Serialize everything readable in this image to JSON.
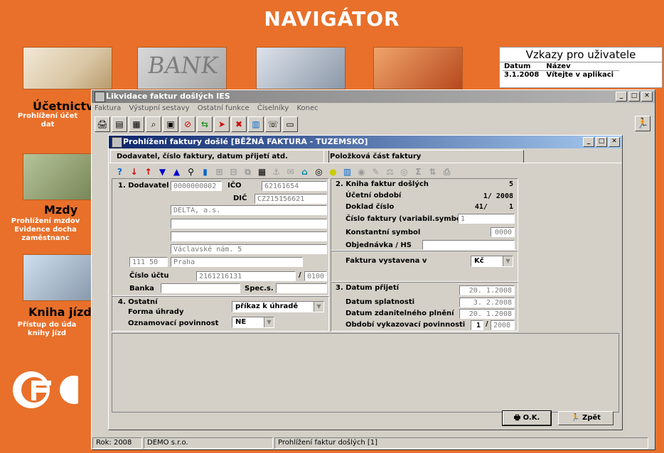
{
  "background": {
    "title": "NAVIGÁTOR",
    "modules": [
      {
        "title": "Účetnictví",
        "desc": [
          "Prohlížení účet",
          "dat"
        ]
      },
      {
        "title": "Mzdy",
        "desc": [
          "Prohlížení mzdov",
          "Evidence docha",
          "zaměstnanc"
        ]
      },
      {
        "title": "Kniha jízd",
        "desc": [
          "Přístup do úda",
          "knihy jízd"
        ]
      }
    ],
    "bank_word": "BANK",
    "messages": {
      "title": "Vzkazy pro uživatele",
      "col_date": "Datum",
      "col_name": "Název",
      "rows": [
        {
          "date": "3.1.2008",
          "name": "Vítejte v aplikaci"
        }
      ]
    }
  },
  "outer_window": {
    "title": "Likvidace faktur došlých  IES",
    "menu": [
      "Faktura",
      "Výstupní sestavy",
      "Ostatní funkce",
      "Číselníky",
      "Konec"
    ],
    "status": [
      "Rok: 2008",
      "DEMO s.r.o.",
      "Prohlížení faktur došlých [1]"
    ]
  },
  "inner_window": {
    "title": "Prohlížení faktury došlé  [BĚŽNÁ FAKTURA - TUZEMSKO]",
    "tabs": [
      "Dodavatel, číslo faktury, datum přijetí atd.",
      "Položková část faktury"
    ],
    "supplier": {
      "section_label": "1. Dodavatel",
      "code": "0000000002",
      "ico_label": "IČO",
      "ico": "62161654",
      "dic_label": "DIČ",
      "dic": "CZ215156621",
      "name": "DELTA, a.s.",
      "line2": "",
      "line3": "",
      "street": "Václavské nám. 5",
      "zip": "111 50",
      "city": "Praha",
      "account_label": "Číslo účtu",
      "account": "2161216131",
      "bank_code": "0100",
      "bank_label": "Banka",
      "bank": "",
      "spec_label": "Spec.s.",
      "spec": ""
    },
    "book": {
      "section_label": "2. Kniha faktur došlých",
      "book_no": "5",
      "period_label": "Účetní období",
      "period": "1/ 2008",
      "doc_label": "Doklad číslo",
      "doc": "41/     1",
      "invoice_no_label": "Číslo faktury (variabil.symbol)",
      "invoice_no": "1",
      "const_label": "Konstantní symbol",
      "const": "0000",
      "order_label": "Objednávka / HS",
      "order": "",
      "currency_label": "Faktura vystavena v",
      "currency": "Kč"
    },
    "other": {
      "section_label": "4. Ostatní",
      "payment_label": "Forma úhrady",
      "payment": "příkaz k úhradě",
      "notify_label": "Oznamovací povinnost",
      "notify": "NE"
    },
    "dates": {
      "section_label": "3. Datum přijetí",
      "received": "20. 1.2008",
      "due_label": "Datum splatnosti",
      "due": "3. 2.2008",
      "taxable_label": "Datum zdanitelného plnění",
      "taxable": "20. 1.2008",
      "report_label": "Období vykazovací povinnosti",
      "report_month": "1",
      "report_year": "2008"
    },
    "ok_label": "O.K.",
    "back_label": "Zpět"
  }
}
